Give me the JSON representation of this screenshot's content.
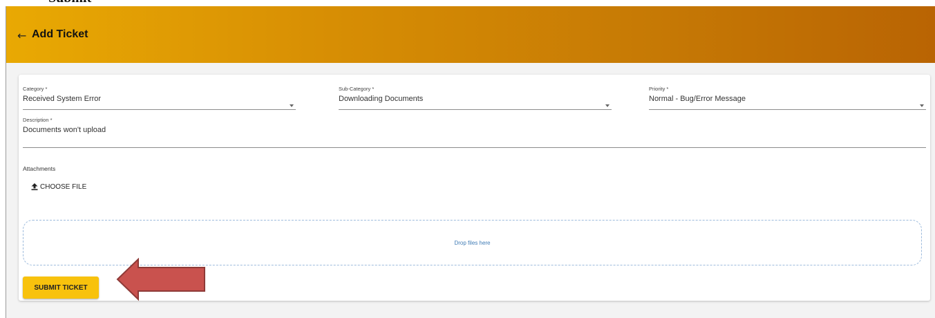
{
  "crop_title": "Submit",
  "header": {
    "back_icon": "arrow-left-icon",
    "title": "Add Ticket",
    "gradient_colors": [
      "#e9a903",
      "#b96403"
    ]
  },
  "form": {
    "category": {
      "label": "Category *",
      "value": "Received System Error"
    },
    "subcategory": {
      "label": "Sub-Category *",
      "value": "Downloading Documents"
    },
    "priority": {
      "label": "Priority *",
      "value": "Normal - Bug/Error Message"
    },
    "description": {
      "label": "Description *",
      "value": "Documents won't upload"
    },
    "attachments_label": "Attachments",
    "choose_file": {
      "icon": "upload-icon",
      "label": "CHOOSE FILE"
    },
    "dropzone_text": "Drop files here",
    "submit_label": "SUBMIT TICKET",
    "submit_color": "#f8c20d"
  },
  "annotation": {
    "icon": "red-arrow-icon",
    "color": "#c9524e"
  }
}
